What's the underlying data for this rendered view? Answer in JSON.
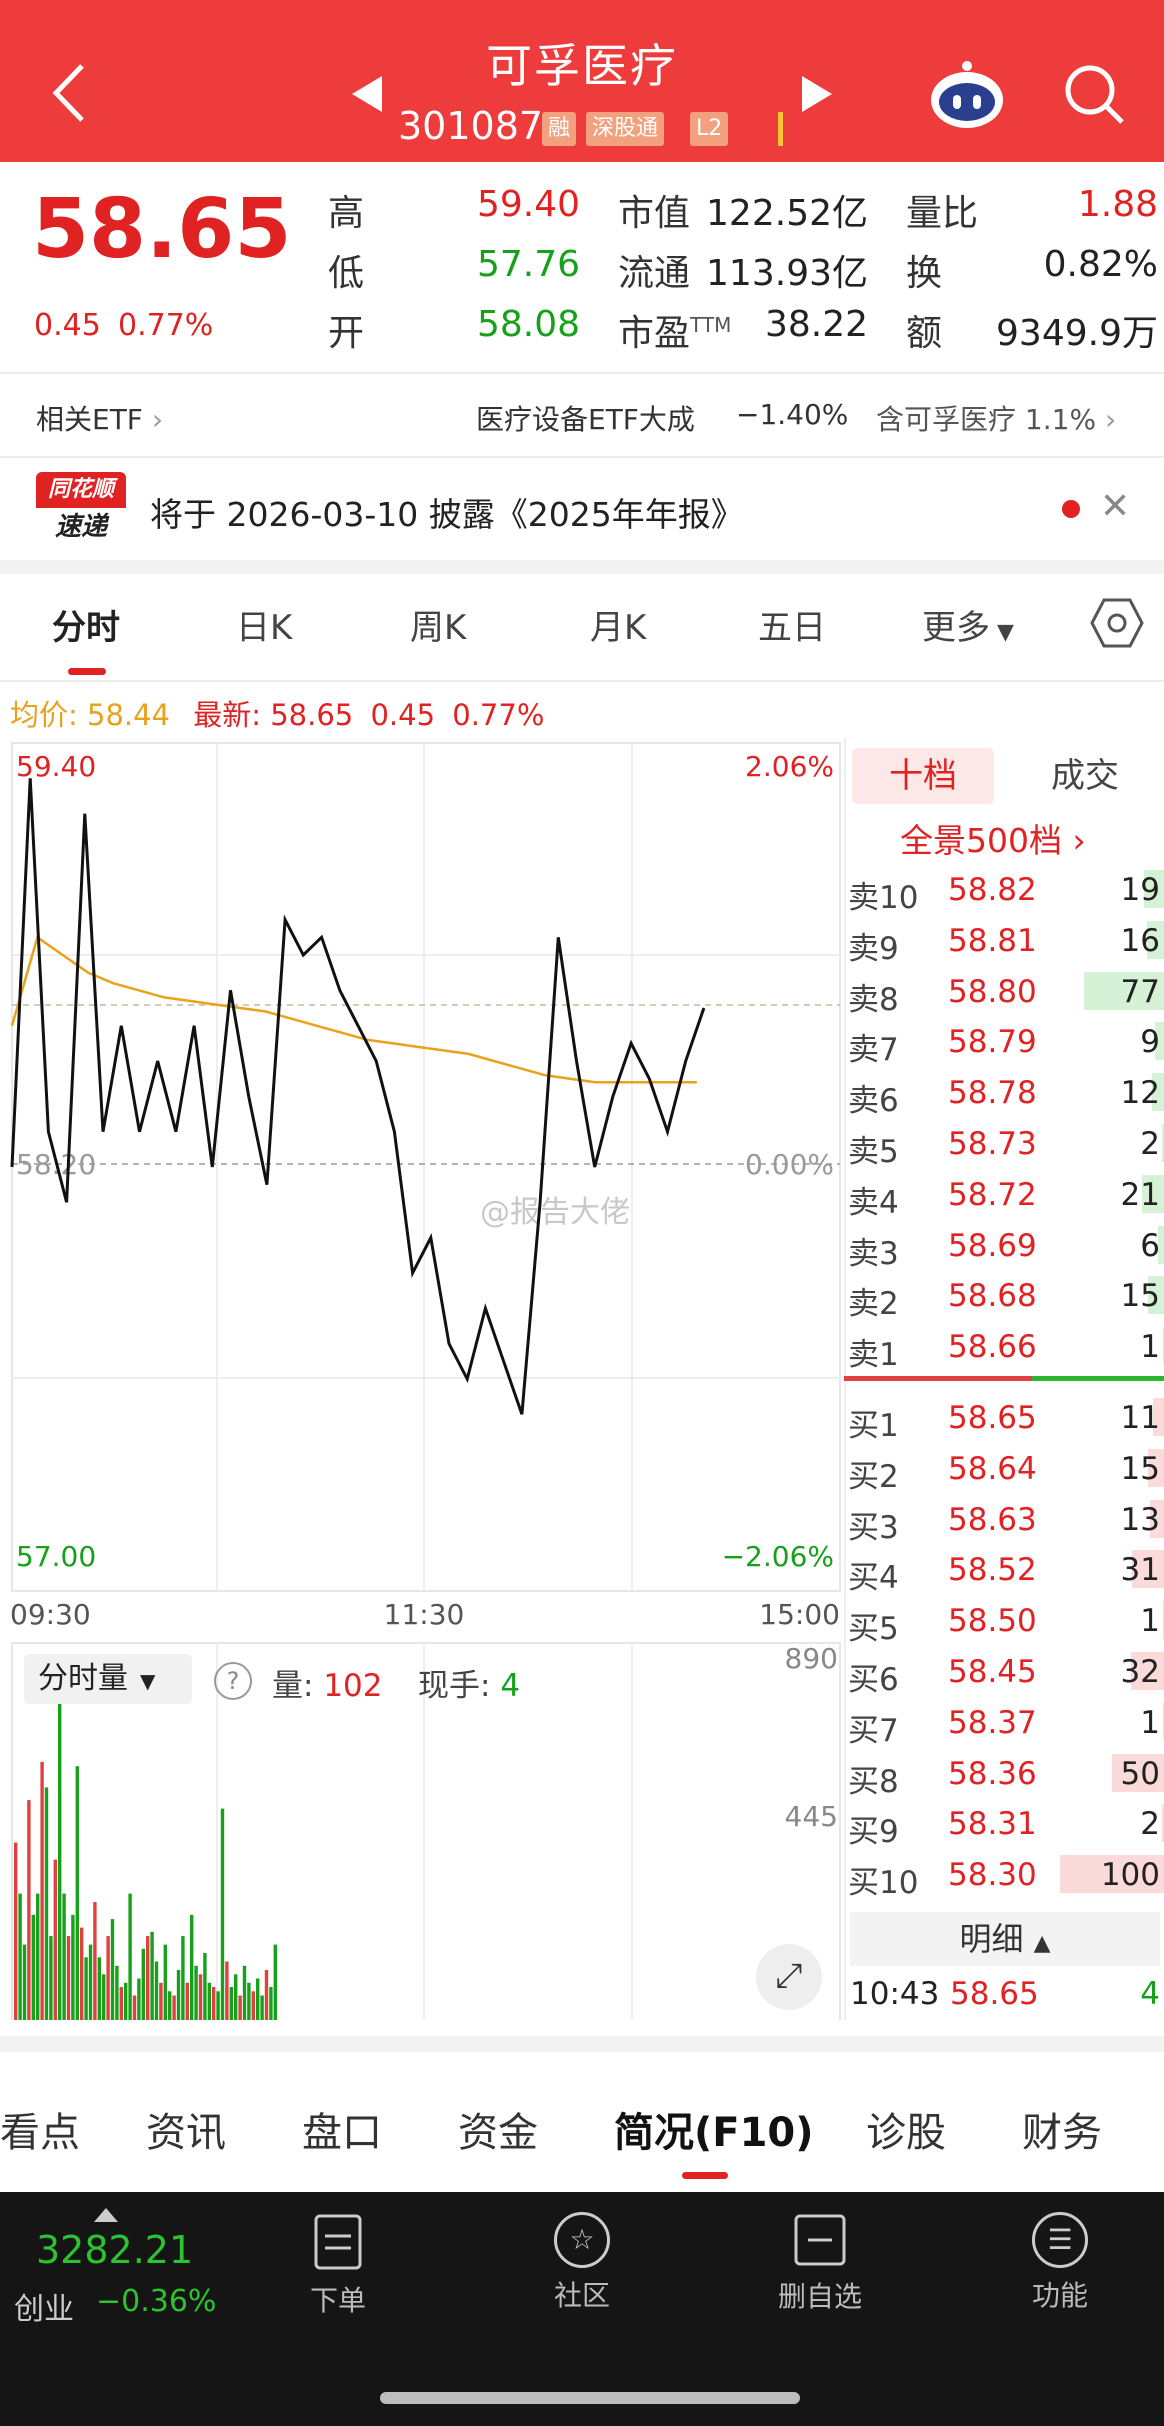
{
  "header": {
    "title": "可孚医疗",
    "code": "301087",
    "tags": [
      "融",
      "深股通",
      "L2"
    ]
  },
  "quote": {
    "price": "58.65",
    "change": "0.45",
    "change_pct": "0.77%",
    "stats": [
      {
        "label": "高",
        "value": "59.40"
      },
      {
        "label": "低",
        "value": "57.76"
      },
      {
        "label": "开",
        "value": "58.08"
      },
      {
        "label": "市值",
        "value": "122.52亿"
      },
      {
        "label": "流通",
        "value": "113.93亿"
      },
      {
        "label": "市盈",
        "sup": "TTM",
        "value": "38.22"
      },
      {
        "label": "量比",
        "value": "1.88"
      },
      {
        "label": "换",
        "value": "0.82%"
      },
      {
        "label": "额",
        "value": "9349.9万"
      }
    ]
  },
  "etf": {
    "label": "相关ETF",
    "name": "医疗设备ETF大成",
    "change": "−1.40%",
    "contains": "含可孚医疗",
    "weight": "1.1%"
  },
  "notice": {
    "logo_line1": "同花顺",
    "logo_line2": "速递",
    "text": "将于 2026-03-10 披露《2025年年报》"
  },
  "tabs": [
    "分时",
    "日K",
    "周K",
    "月K",
    "五日",
    "更多"
  ],
  "chart": {
    "avg_label": "均价: 58.44",
    "latest_label": "最新: 58.65",
    "latest_change": "0.45",
    "latest_pct": "0.77%",
    "price_high": "59.40",
    "price_mid": "58.20",
    "price_low": "57.00",
    "pct_high": "2.06%",
    "pct_mid": "0.00%",
    "pct_low": "−2.06%",
    "times": [
      "09:30",
      "11:30",
      "15:00"
    ],
    "watermark": "@报告大佬",
    "vol_selector": "分时量",
    "vol_label": "量:",
    "vol_value": "102",
    "hand_label": "现手:",
    "hand_value": "4",
    "vol_max": "890",
    "vol_mid": "445"
  },
  "chart_data": {
    "type": "line",
    "x_range": [
      "09:30",
      "15:00"
    ],
    "ylim": [
      57.0,
      59.4
    ],
    "prev_close": 58.2,
    "price": [
      58.2,
      59.3,
      58.3,
      58.1,
      59.2,
      58.3,
      58.6,
      58.3,
      58.5,
      58.3,
      58.6,
      58.2,
      58.7,
      58.4,
      58.15,
      58.9,
      58.8,
      58.85,
      58.7,
      58.6,
      58.5,
      58.3,
      57.9,
      58.0,
      57.7,
      57.6,
      57.8,
      57.65,
      57.5,
      58.1,
      58.85,
      58.5,
      58.2,
      58.4,
      58.55,
      58.45,
      58.3,
      58.5,
      58.65
    ],
    "avg": [
      58.6,
      58.85,
      58.8,
      58.75,
      58.72,
      58.7,
      58.68,
      58.67,
      58.66,
      58.65,
      58.64,
      58.62,
      58.6,
      58.58,
      58.56,
      58.55,
      58.54,
      58.53,
      58.52,
      58.5,
      58.48,
      58.46,
      58.45,
      58.44,
      58.44,
      58.44,
      58.44,
      58.44
    ],
    "volume": [
      420,
      300,
      180,
      520,
      250,
      300,
      610,
      550,
      200,
      380,
      820,
      300,
      200,
      250,
      600,
      220,
      150,
      180,
      280,
      150,
      110,
      200,
      240,
      130,
      80,
      90,
      300,
      60,
      100,
      170,
      200,
      210,
      140,
      90,
      180,
      70,
      60,
      120,
      200,
      90,
      250,
      130,
      110,
      160,
      90,
      80,
      70,
      500,
      140,
      80,
      110,
      60,
      130,
      90,
      70,
      100,
      60,
      120,
      80,
      180
    ]
  },
  "orderbook": {
    "tab_active": "十档",
    "tab_other": "成交",
    "panorama": "全景500档",
    "sells": [
      {
        "label": "卖10",
        "price": "58.82",
        "vol": "19"
      },
      {
        "label": "卖9",
        "price": "58.81",
        "vol": "16"
      },
      {
        "label": "卖8",
        "price": "58.80",
        "vol": "77"
      },
      {
        "label": "卖7",
        "price": "58.79",
        "vol": "9"
      },
      {
        "label": "卖6",
        "price": "58.78",
        "vol": "12"
      },
      {
        "label": "卖5",
        "price": "58.73",
        "vol": "2"
      },
      {
        "label": "卖4",
        "price": "58.72",
        "vol": "21"
      },
      {
        "label": "卖3",
        "price": "58.69",
        "vol": "6"
      },
      {
        "label": "卖2",
        "price": "58.68",
        "vol": "15"
      },
      {
        "label": "卖1",
        "price": "58.66",
        "vol": "1"
      }
    ],
    "buys": [
      {
        "label": "买1",
        "price": "58.65",
        "vol": "11"
      },
      {
        "label": "买2",
        "price": "58.64",
        "vol": "15"
      },
      {
        "label": "买3",
        "price": "58.63",
        "vol": "13"
      },
      {
        "label": "买4",
        "price": "58.52",
        "vol": "31"
      },
      {
        "label": "买5",
        "price": "58.50",
        "vol": "1"
      },
      {
        "label": "买6",
        "price": "58.45",
        "vol": "32"
      },
      {
        "label": "买7",
        "price": "58.37",
        "vol": "1"
      },
      {
        "label": "买8",
        "price": "58.36",
        "vol": "50"
      },
      {
        "label": "买9",
        "price": "58.31",
        "vol": "2"
      },
      {
        "label": "买10",
        "price": "58.30",
        "vol": "100"
      }
    ],
    "detail_label": "明细",
    "detail_time": "10:43",
    "detail_price": "58.65",
    "detail_vol": "4"
  },
  "bottom_tabs": [
    "看点",
    "资讯",
    "盘口",
    "资金",
    "简况(F10)",
    "诊股",
    "财务"
  ],
  "index": {
    "value": "3282.21",
    "name": "创业",
    "change": "−0.36%"
  },
  "nav": [
    "下单",
    "社区",
    "删自选",
    "功能"
  ],
  "colors": {
    "header": "#ee3b3b",
    "up": "#e02222",
    "down": "#16a11a",
    "avg_line": "#e8a21c"
  }
}
